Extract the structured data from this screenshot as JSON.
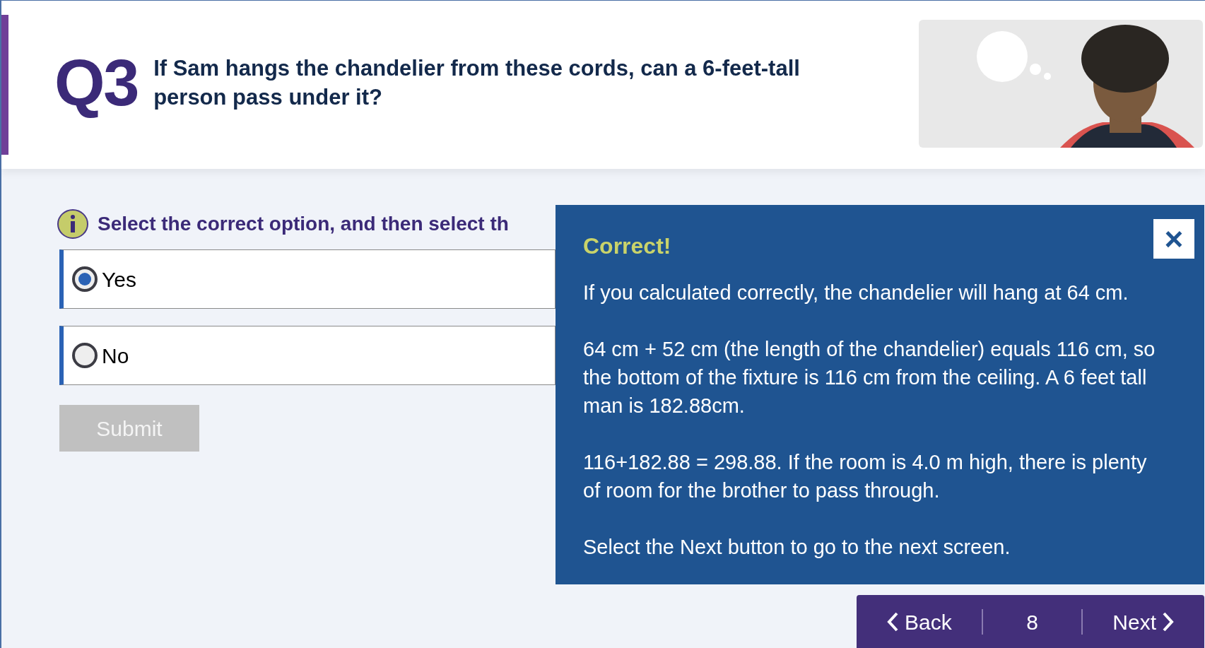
{
  "question": {
    "number": "Q3",
    "text": "If Sam hangs the chandelier from these cords, can a 6-feet-tall person pass under it?"
  },
  "instruction": "Select the correct option, and then select th",
  "options": [
    {
      "label": "Yes",
      "selected": true
    },
    {
      "label": "No",
      "selected": false
    }
  ],
  "submit": {
    "label": "Submit",
    "disabled": true
  },
  "feedback": {
    "title": "Correct!",
    "close": "×",
    "paragraphs": [
      "If you calculated correctly, the chandelier will hang at 64 cm.",
      "64 cm + 52 cm (the length of the chandelier) equals 116 cm, so the bottom of the fixture is 116 cm from the ceiling. A 6 feet tall man is 182.88cm.",
      "116+182.88 = 298.88. If the room is 4.0 m high, there is plenty of room for the brother to pass through.",
      "Select the Next button to go to the next screen."
    ]
  },
  "nav": {
    "back": "Back",
    "page": "8",
    "next": "Next"
  }
}
